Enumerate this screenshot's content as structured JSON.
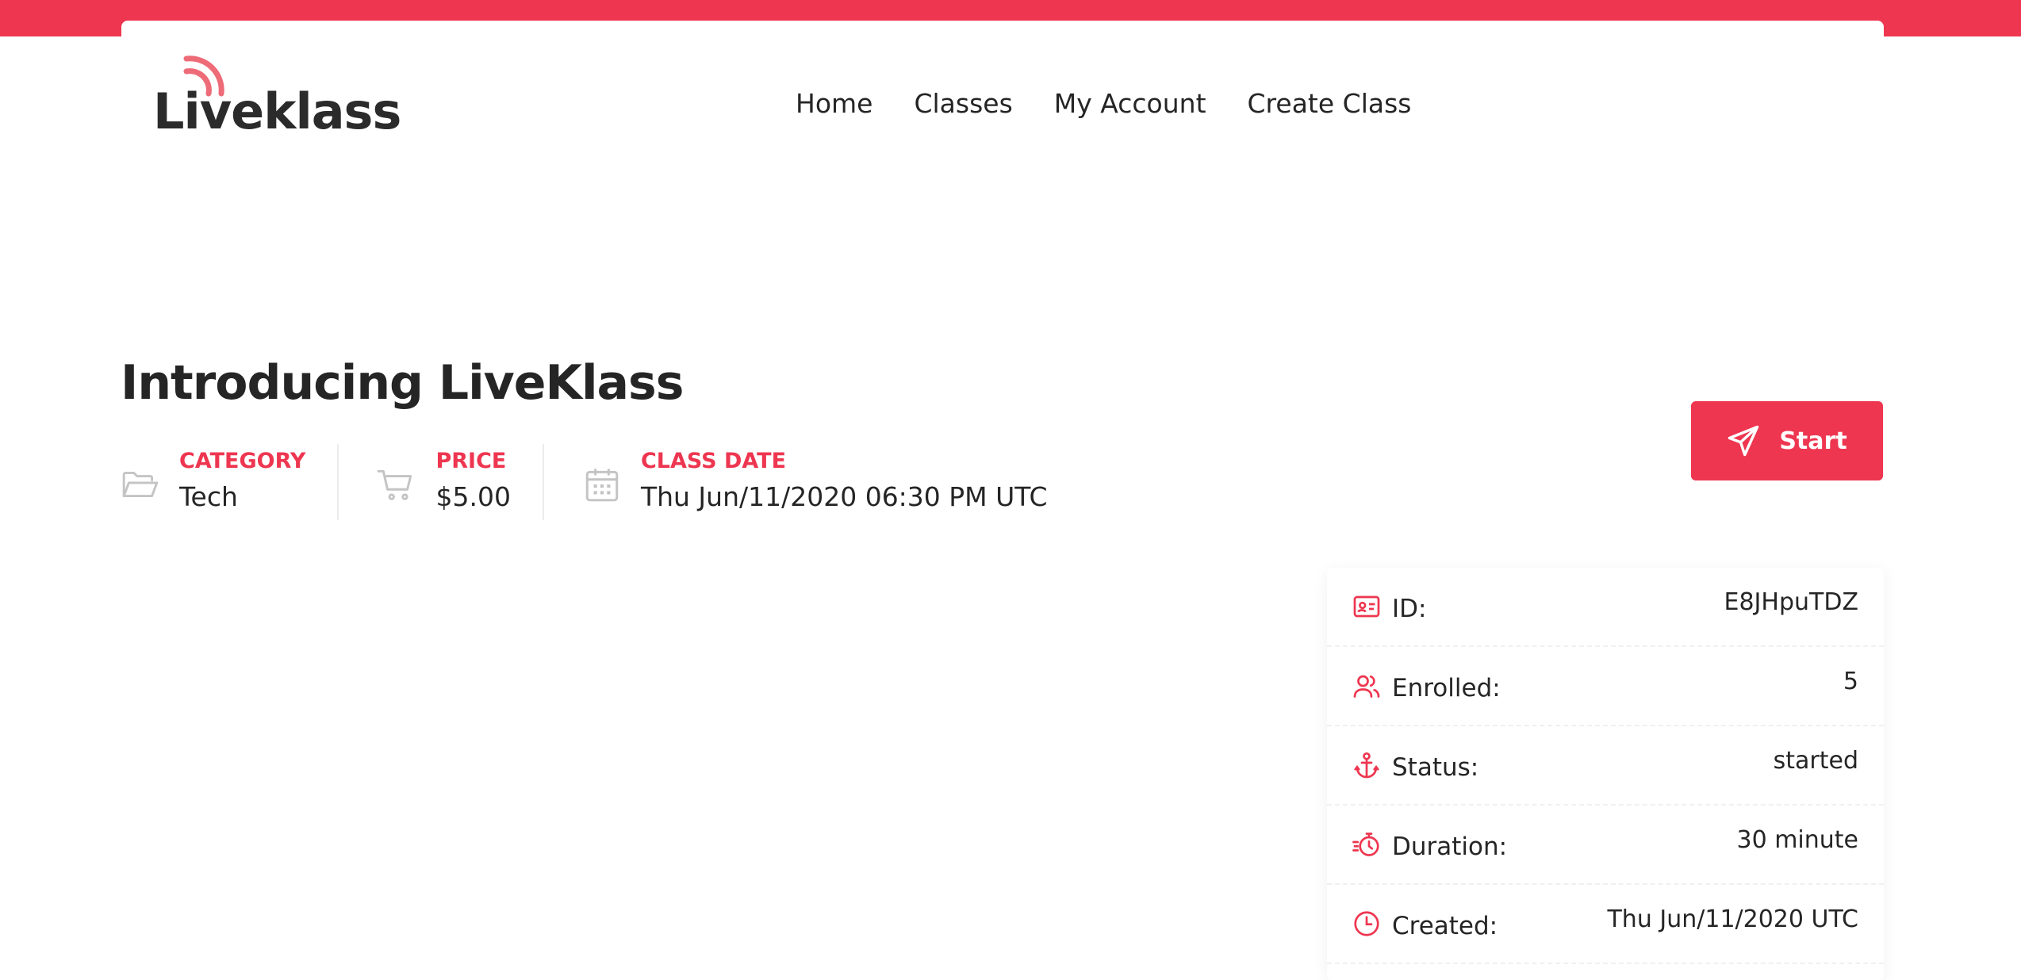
{
  "brand": {
    "logo_text": "Liveklass",
    "accent_color": "#ee3650"
  },
  "nav": {
    "items": [
      {
        "label": "Home"
      },
      {
        "label": "Classes"
      },
      {
        "label": "My Account"
      },
      {
        "label": "Create Class"
      }
    ]
  },
  "class": {
    "title": "Introducing LiveKlass",
    "meta": [
      {
        "label": "CATEGORY",
        "value": "Tech",
        "icon": "folder-open-icon"
      },
      {
        "label": "PRICE",
        "value": "$5.00",
        "icon": "shopping-cart-icon"
      },
      {
        "label": "CLASS DATE",
        "value": "Thu Jun/11/2020 06:30 PM UTC",
        "icon": "calendar-icon"
      }
    ],
    "start_label": "Start",
    "start_icon": "paper-plane-icon"
  },
  "info": {
    "rows": [
      {
        "label": "ID:",
        "value": "E8JHpuTDZ",
        "icon": "id-card-icon"
      },
      {
        "label": "Enrolled:",
        "value": "5",
        "icon": "users-icon"
      },
      {
        "label": "Status:",
        "value": "started",
        "icon": "anchor-icon"
      },
      {
        "label": "Duration:",
        "value": "30 minute",
        "icon": "stopwatch-icon"
      },
      {
        "label": "Created:",
        "value": "Thu Jun/11/2020 UTC",
        "icon": "clock-icon"
      }
    ]
  }
}
